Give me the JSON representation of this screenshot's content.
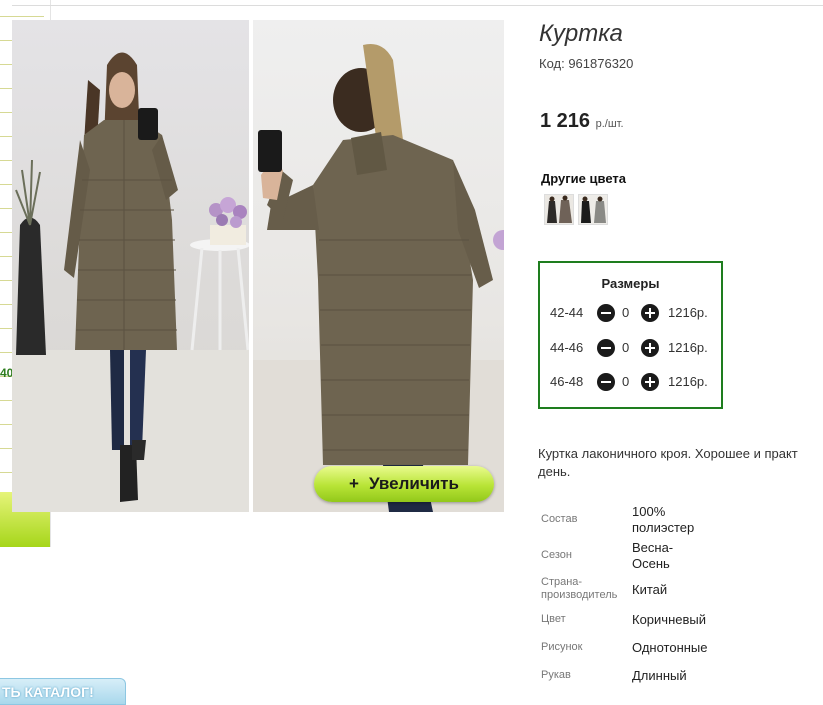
{
  "sidebar": {
    "number_fragment": "40"
  },
  "catalog_button": {
    "label": "ТЬ КАТАЛОГ!"
  },
  "zoom_button": {
    "icon": "+",
    "label": "Увеличить"
  },
  "product": {
    "title": "Куртка",
    "code": "Код: 961876320",
    "price": "1 216",
    "price_unit": "р./шт.",
    "other_colors_title": "Другие цвета",
    "other_colors": [
      {
        "name": "color-variant-1",
        "colors": [
          "#2d2a28",
          "#6f6258"
        ]
      },
      {
        "name": "color-variant-2",
        "colors": [
          "#1b1b1b",
          "#8a8a86"
        ]
      }
    ],
    "sizes_title": "Размеры",
    "sizes": [
      {
        "label": "42-44",
        "qty": "0",
        "price": "1216р."
      },
      {
        "label": "44-46",
        "qty": "0",
        "price": "1216р."
      },
      {
        "label": "46-48",
        "qty": "0",
        "price": "1216р."
      }
    ],
    "description_line1": "Куртка лаконичного кроя. Хорошее и практ",
    "description_line2": "день.",
    "specs": [
      {
        "label": "Состав",
        "value_line1": "100%",
        "value_line2": "полиэстер"
      },
      {
        "label": "Сезон",
        "value_line1": "Весна-",
        "value_line2": "Осень"
      },
      {
        "label": "Страна-",
        "label_line2": "производитель",
        "value_line1": "Китай"
      },
      {
        "label": "Цвет",
        "value_line1": "Коричневый"
      },
      {
        "label": "Рисунок",
        "value_line1": "Однотонные"
      },
      {
        "label": "Рукав",
        "value_line1": "Длинный"
      }
    ]
  },
  "colors": {
    "accent_green": "#1e7d1e",
    "jacket": "#6e6450",
    "zoom_button": "#b8e436"
  }
}
